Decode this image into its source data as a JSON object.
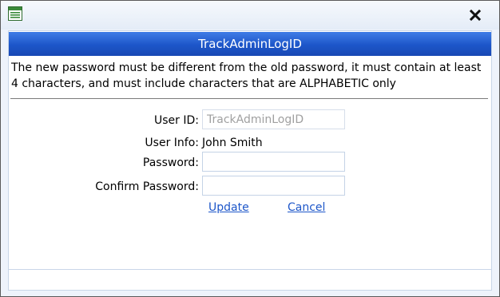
{
  "dialog": {
    "header_title": "TrackAdminLogID",
    "instructions": "The new password must be different from the old password, it must contain at least 4 characters, and must include characters that are ALPHABETIC only"
  },
  "form": {
    "user_id_label": "User ID:",
    "user_id_value": "TrackAdminLogID",
    "user_info_label": "User Info:",
    "user_info_value": "John Smith",
    "password_label": "Password:",
    "password_value": "",
    "confirm_password_label": "Confirm Password:",
    "confirm_password_value": ""
  },
  "actions": {
    "update_label": "Update",
    "cancel_label": "Cancel"
  },
  "icons": {
    "app": "window-icon",
    "close": "close-icon"
  },
  "colors": {
    "header_band": "#1d56c9",
    "link": "#1d56c9"
  }
}
